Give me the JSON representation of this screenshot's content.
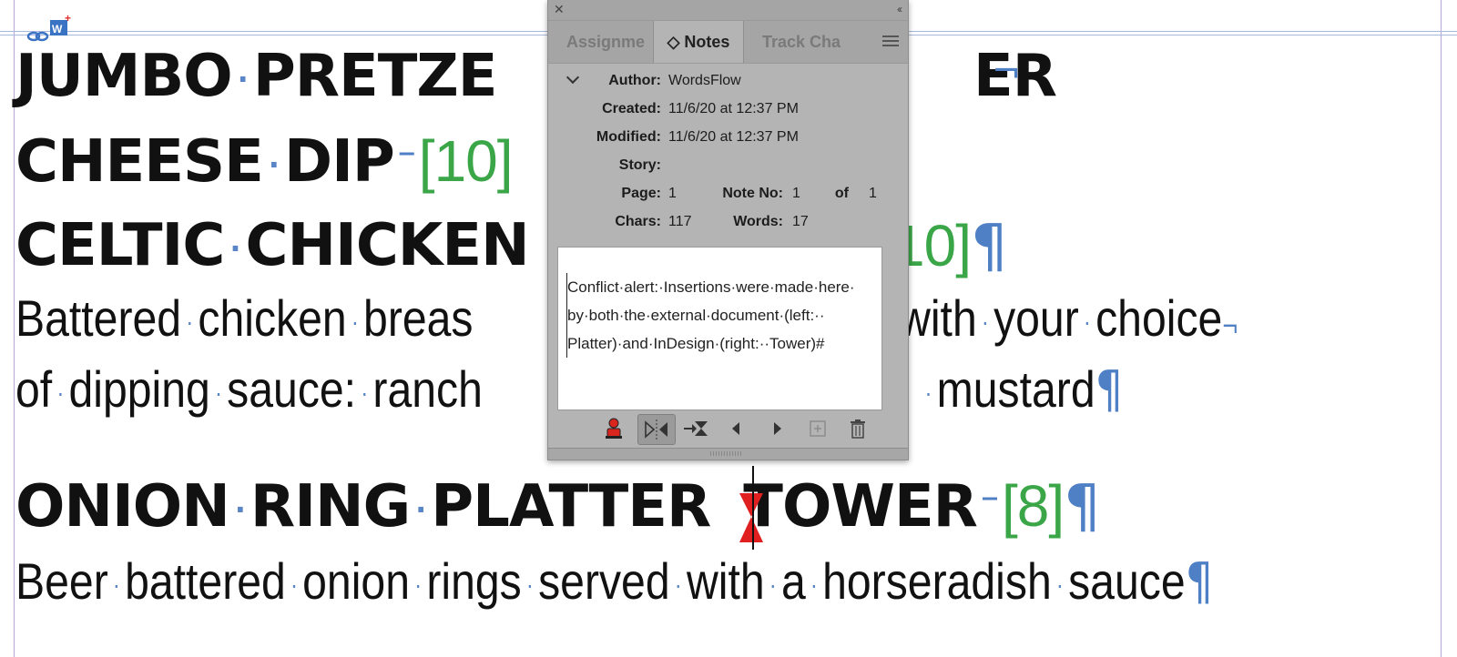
{
  "document": {
    "line1": {
      "w1": "JUMBO",
      "w2": "PRETZE",
      "w3": "ER",
      "eol": "¬"
    },
    "line2": {
      "w1": "CHEESE",
      "w2": "DIP",
      "dash": "‾",
      "price": "[10]"
    },
    "line3": {
      "w1": "CELTIC",
      "w2": "CHICKEN",
      "price": "10]",
      "pilcrow": "¶"
    },
    "line4": {
      "w1": "Battered",
      "w2": "chicken",
      "w3": "breas",
      "w4": "with",
      "w5": "your",
      "w6": "choice",
      "eol": "¬"
    },
    "line5": {
      "w1": "of",
      "w2": "dipping",
      "w3": "sauce:",
      "w4": "ranch",
      "w5": "mustard",
      "pilcrow": "¶"
    },
    "line6": {
      "w1": "ONION",
      "w2": "RING",
      "w3": "PLATTER",
      "w4": "TOWER",
      "dash": "‾",
      "price": "[8]",
      "pilcrow": "¶"
    },
    "line7": {
      "w1": "Beer",
      "w2": "battered",
      "w3": "onion",
      "w4": "rings",
      "w5": "served",
      "w6": "with",
      "w7": "a",
      "w8": "horseradish",
      "w9": "sauce",
      "pilcrow": "¶"
    },
    "space_marker": "·"
  },
  "panel": {
    "tabs": [
      {
        "label": "Assignme"
      },
      {
        "label": "◇ Notes"
      },
      {
        "label": "Track Cha"
      }
    ],
    "labels": {
      "author": "Author:",
      "created": "Created:",
      "modified": "Modified:",
      "story": "Story:",
      "page": "Page:",
      "note_no": "Note No:",
      "of": "of",
      "chars": "Chars:",
      "words": "Words:"
    },
    "values": {
      "author": "WordsFlow",
      "created": "11/6/20 at 12:37 PM",
      "modified": "11/6/20 at 12:37 PM",
      "story": "",
      "page": "1",
      "note_no": "1",
      "of_total": "1",
      "chars": "117",
      "words": "17"
    },
    "note": {
      "line1": "Conflict·alert:·Insertions·were·made·here·",
      "line2": "by·both·the·external·document·(left:··",
      "line3": "Platter)·and·InDesign·(right:··Tower)#"
    },
    "toolbar_icons": [
      "user-note-icon",
      "split-note-icon",
      "convert-note-icon",
      "previous-note-icon",
      "next-note-icon",
      "new-note-icon",
      "delete-note-icon"
    ]
  },
  "colors": {
    "price": "#3aa648",
    "hidden_char": "#4f7fc4",
    "panel_bg": "#b4b4b4",
    "note_marker": "#e02020"
  }
}
